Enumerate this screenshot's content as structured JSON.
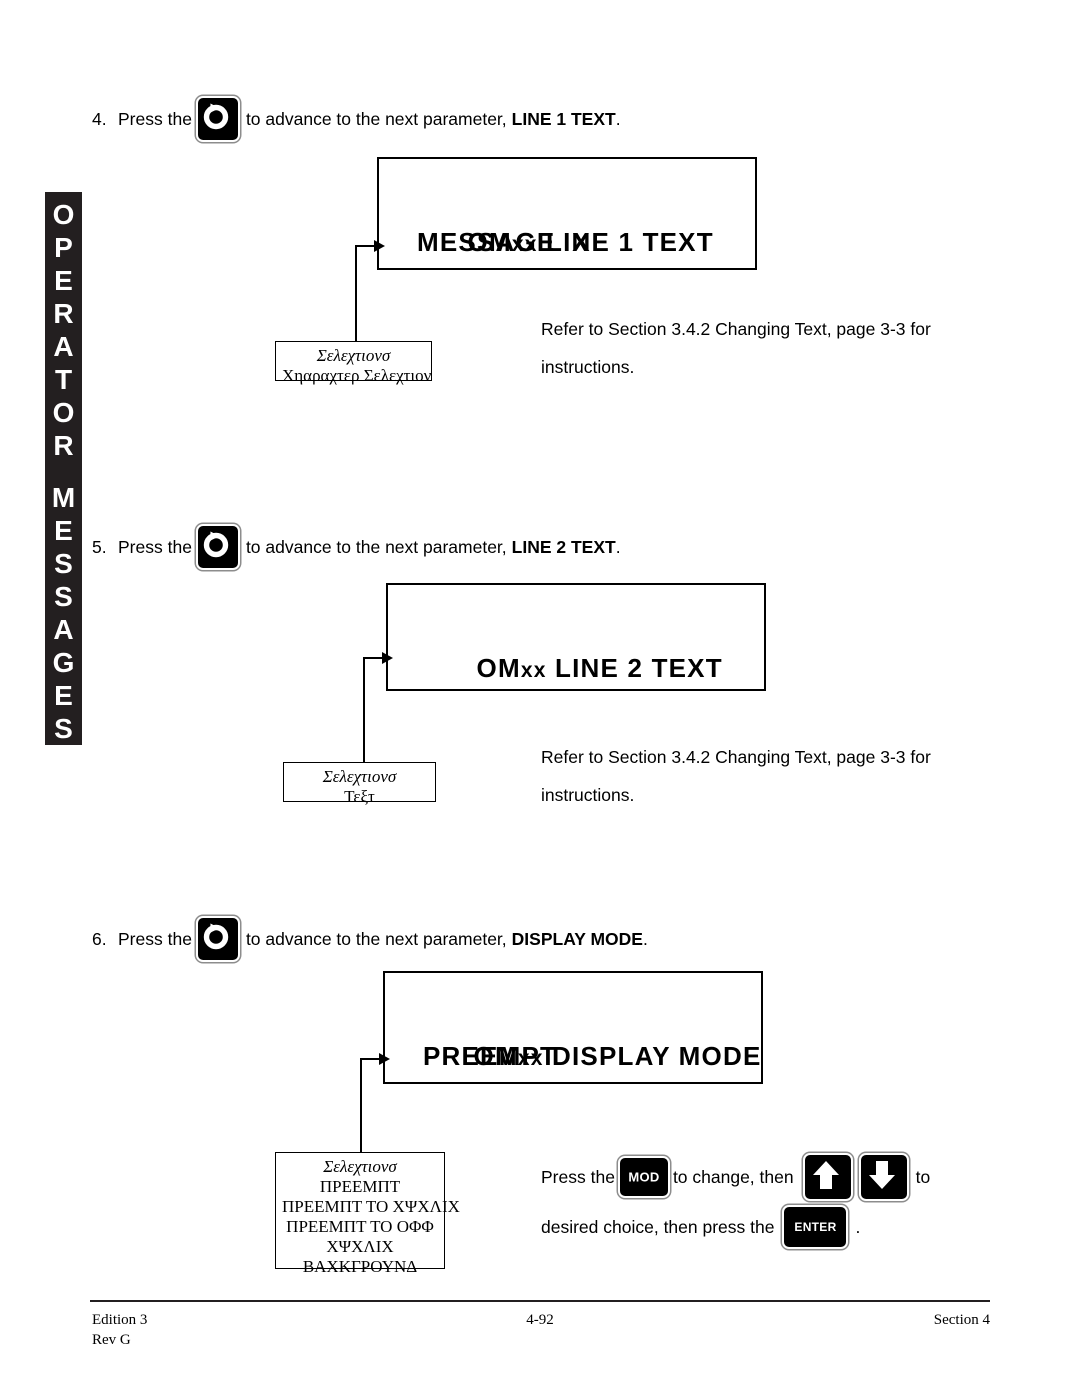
{
  "side_tab": {
    "text": "OPERATOR MESSAGES",
    "line1": "OPERATOR",
    "line2": "MESSAGES",
    "background": "#231f20",
    "color": "#ffffff"
  },
  "steps": [
    {
      "number": "4.",
      "before_key": "Press the",
      "key": "advance-key-icon",
      "after_key": "to advance to the next parameter,",
      "parameter": "LINE 1 TEXT",
      "period": "."
    },
    {
      "number": "5.",
      "before_key": "Press the",
      "key": "advance-key-icon",
      "after_key": "to advance to the next parameter,",
      "parameter": "LINE 2 TEXT",
      "period": "."
    },
    {
      "number": "6.",
      "before_key": "Press the",
      "key": "advance-key-icon",
      "after_key": "to advance to the next parameter,",
      "parameter": "DISPLAY MODE",
      "period": "."
    }
  ],
  "displays": [
    {
      "line1_prefix": "OM",
      "line1_suffix": "xx",
      "line1_rest": " LINE 1 TEXT",
      "line2": "MESSAGE  X"
    },
    {
      "line1_prefix": "OM",
      "line1_suffix": "xx",
      "line1_rest": " LINE 2 TEXT",
      "line2": ""
    },
    {
      "line1_prefix": "OM",
      "line1_suffix": "xx",
      "line1_rest": " DISPLAY MODE",
      "line2": "PREEMPT"
    }
  ],
  "selection_boxes": [
    {
      "heading": "Σελεχτιονσ",
      "options": [
        "Χηαραχτερ  Σελεχτιον"
      ]
    },
    {
      "heading": "Σελεχτιονσ",
      "options": [
        "Τεξτ"
      ]
    },
    {
      "heading": "Σελεχτιονσ",
      "options": [
        "ΠΡΕΕΜΠΤ",
        "ΠΡΕΕΜΠΤ ΤΟ ΧΨΧΛΙΧ",
        "ΠΡΕΕΜΠΤ ΤΟ ΟΦΦ",
        "ΧΨΧΛΙΧ",
        "ΒΑΧΚΓΡΟΥΝΔ"
      ]
    }
  ],
  "refer_notes": [
    {
      "line1": "Refer to Section 3.4.2 Changing Text, page 3-3 for",
      "line2": "instructions."
    },
    {
      "line1": "Refer to Section 3.4.2 Changing Text, page 3-3 for",
      "line2": "instructions."
    }
  ],
  "mod_instruction": {
    "part1": "Press the",
    "mod_key_label": "MOD",
    "part2": "to change, then",
    "up_key": "up-arrow-icon",
    "down_key": "down-arrow-icon",
    "part3": "to",
    "part4": "desired choice, then press the",
    "enter_key_label": "ENTER",
    "part5": "."
  },
  "footer": {
    "edition": "Edition 3",
    "revision": "Rev G",
    "page_number": "4-92",
    "section": "Section 4"
  }
}
